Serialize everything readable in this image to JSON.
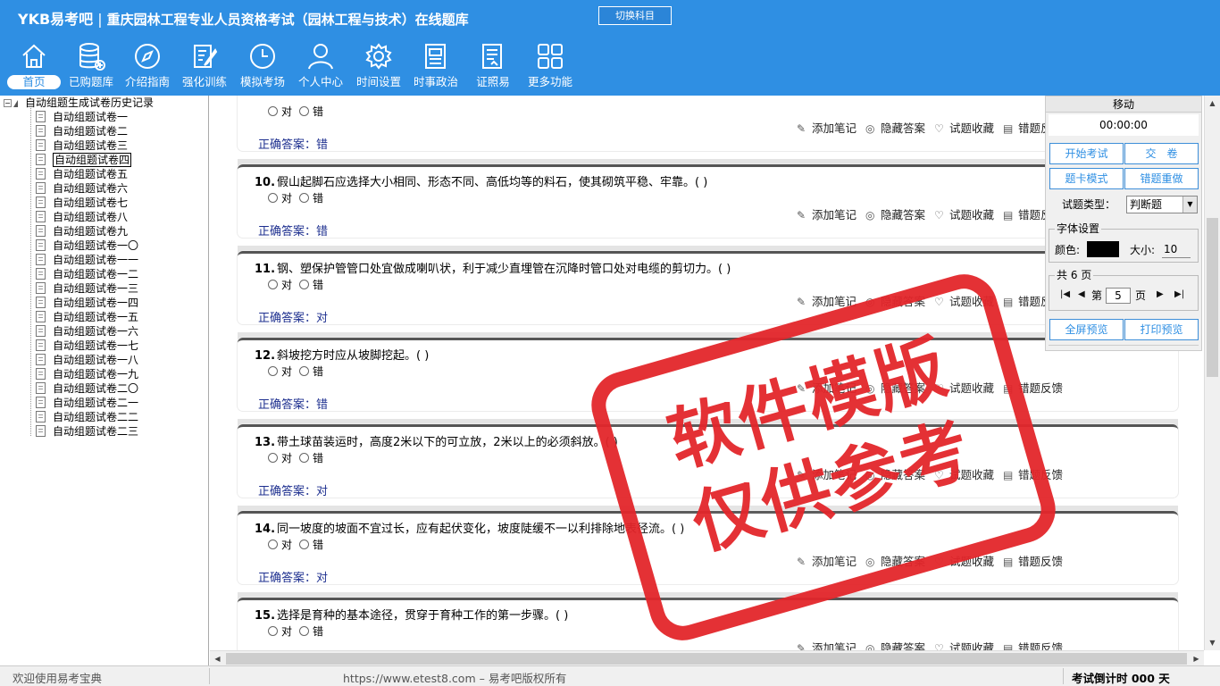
{
  "header": {
    "brand": "YKB易考吧",
    "title": "重庆园林工程专业人员资格考试（园林工程与技术）在线题库",
    "switch_button": "切换科目"
  },
  "nav": [
    {
      "label": "首页",
      "icon": "home-icon",
      "active": true
    },
    {
      "label": "已购题库",
      "icon": "database-icon"
    },
    {
      "label": "介绍指南",
      "icon": "compass-icon"
    },
    {
      "label": "强化训练",
      "icon": "edit-icon"
    },
    {
      "label": "模拟考场",
      "icon": "clock-icon"
    },
    {
      "label": "个人中心",
      "icon": "user-icon"
    },
    {
      "label": "时间设置",
      "icon": "gear-icon"
    },
    {
      "label": "时事政治",
      "icon": "newspaper-icon"
    },
    {
      "label": "证照易",
      "icon": "certificate-icon"
    },
    {
      "label": "更多功能",
      "icon": "grid-icon"
    }
  ],
  "tree": {
    "root": "自动组题生成试卷历史记录",
    "items": [
      "自动组题试卷一",
      "自动组题试卷二",
      "自动组题试卷三",
      "自动组题试卷四",
      "自动组题试卷五",
      "自动组题试卷六",
      "自动组题试卷七",
      "自动组题试卷八",
      "自动组题试卷九",
      "自动组题试卷一〇",
      "自动组题试卷一一",
      "自动组题试卷一二",
      "自动组题试卷一三",
      "自动组题试卷一四",
      "自动组题试卷一五",
      "自动组题试卷一六",
      "自动组题试卷一七",
      "自动组题试卷一八",
      "自动组题试卷一九",
      "自动组题试卷二〇",
      "自动组题试卷二一",
      "自动组题试卷二二",
      "自动组题试卷二三"
    ],
    "selected": "自动组题试卷四"
  },
  "options": {
    "a": "对",
    "b": "错"
  },
  "actions": {
    "note": "添加笔记",
    "hide": "隐藏答案",
    "fav": "试题收藏",
    "report": "错题反馈"
  },
  "answer_prefix": "正确答案：",
  "questions": [
    {
      "num": "",
      "text": "",
      "answer": "错"
    },
    {
      "num": "10.",
      "text": "假山起脚石应选择大小相同、形态不同、高低均等的料石，使其砌筑平稳、牢靠。( )",
      "answer": "错"
    },
    {
      "num": "11.",
      "text": "钢、塑保护管管口处宜做成喇叭状，利于减少直埋管在沉降时管口处对电缆的剪切力。( )",
      "answer": "对"
    },
    {
      "num": "12.",
      "text": "斜坡挖方时应从坡脚挖起。( )",
      "answer": "错"
    },
    {
      "num": "13.",
      "text": "带土球苗装运时，高度2米以下的可立放，2米以上的必须斜放。( )",
      "answer": "对"
    },
    {
      "num": "14.",
      "text": "同一坡度的坡面不宜过长，应有起伏变化，坡度陡缓不一以利排除地表径流。( )",
      "answer": "对"
    },
    {
      "num": "15.",
      "text": "选择是育种的基本途径，贯穿于育种工作的第一步骤。( )",
      "answer": ""
    }
  ],
  "stamp": {
    "line1": "软件模版",
    "line2": "仅供参考"
  },
  "panel": {
    "header": "移动",
    "timer": "00:00:00",
    "start": "开始考试",
    "submit": "交　卷",
    "card_mode": "题卡模式",
    "redo": "错题重做",
    "type_label": "试题类型：",
    "type_value": "判断题",
    "font_legend": "字体设置",
    "color_label": "颜色:",
    "size_label": "大小:",
    "size_value": "10",
    "pages_legend": "共 6 页",
    "page_prefix": "第",
    "page_value": "5",
    "page_suffix": "页",
    "fullscreen": "全屏预览",
    "print": "打印预览"
  },
  "status": {
    "welcome": "欢迎使用易考宝典",
    "copyright": "https://www.etest8.com – 易考吧版权所有",
    "countdown": "考试倒计时 000 天"
  },
  "colors": {
    "header": "#2f8fe3",
    "stamp": "#e3262b",
    "answer": "#1d2f8f"
  }
}
